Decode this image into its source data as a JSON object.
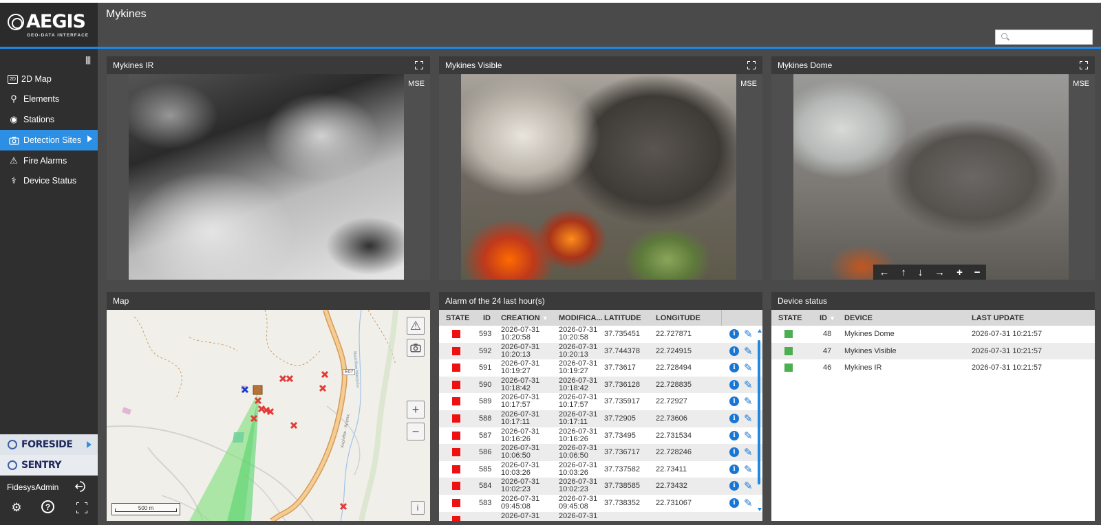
{
  "brand": {
    "name": "AEGIS",
    "tagline": "GEO-DATA INTERFACE"
  },
  "header": {
    "title": "Mykines",
    "search_placeholder": ""
  },
  "sidebar": {
    "items": [
      {
        "label": "2D Map",
        "icon": "map-2d-icon",
        "glyph": "2D"
      },
      {
        "label": "Elements",
        "icon": "location-pin-icon",
        "glyph": "⚲"
      },
      {
        "label": "Stations",
        "icon": "station-icon",
        "glyph": "◉"
      },
      {
        "label": "Detection Sites",
        "icon": "camera-icon",
        "glyph": "📷",
        "active": true
      },
      {
        "label": "Fire Alarms",
        "icon": "warning-icon",
        "glyph": "⚠"
      },
      {
        "label": "Device Status",
        "icon": "stethoscope-icon",
        "glyph": "⚕"
      }
    ],
    "products": [
      "FORESIDE",
      "SENTRY"
    ],
    "user": "FidesysAdmin"
  },
  "cameras": [
    {
      "title": "Mykines IR",
      "badge": "MSE"
    },
    {
      "title": "Mykines Visible",
      "badge": "MSE"
    },
    {
      "title": "Mykines Dome",
      "badge": "MSE"
    }
  ],
  "ptz": [
    "←",
    "↑",
    "↓",
    "→",
    "+",
    "−"
  ],
  "map": {
    "title": "Map",
    "scale_label": "500 m",
    "road_label": "E07",
    "street_label_1": "Ναυπλίου Μυκηνών",
    "street_label_2": "Κορίνθου - Άργους",
    "info_label": "i"
  },
  "alarms": {
    "title": "Alarm of the 24 last hour(s)",
    "columns": [
      "STATE",
      "ID",
      "CREATION",
      "MODIFICA...",
      "LATITUDE",
      "LONGITUDE"
    ],
    "state_color": "#ee1111",
    "rows": [
      {
        "id": "593",
        "c_date": "2026-07-31",
        "c_time": "10:20:58",
        "m_date": "2026-07-31",
        "m_time": "10:20:58",
        "lat": "37.735451",
        "lon": "22.727871"
      },
      {
        "id": "592",
        "c_date": "2026-07-31",
        "c_time": "10:20:13",
        "m_date": "2026-07-31",
        "m_time": "10:20:13",
        "lat": "37.744378",
        "lon": "22.724915"
      },
      {
        "id": "591",
        "c_date": "2026-07-31",
        "c_time": "10:19:27",
        "m_date": "2026-07-31",
        "m_time": "10:19:27",
        "lat": "37.73617",
        "lon": "22.728494"
      },
      {
        "id": "590",
        "c_date": "2026-07-31",
        "c_time": "10:18:42",
        "m_date": "2026-07-31",
        "m_time": "10:18:42",
        "lat": "37.736128",
        "lon": "22.728835"
      },
      {
        "id": "589",
        "c_date": "2026-07-31",
        "c_time": "10:17:57",
        "m_date": "2026-07-31",
        "m_time": "10:17:57",
        "lat": "37.735917",
        "lon": "22.72927"
      },
      {
        "id": "588",
        "c_date": "2026-07-31",
        "c_time": "10:17:11",
        "m_date": "2026-07-31",
        "m_time": "10:17:11",
        "lat": "37.72905",
        "lon": "22.73606"
      },
      {
        "id": "587",
        "c_date": "2026-07-31",
        "c_time": "10:16:26",
        "m_date": "2026-07-31",
        "m_time": "10:16:26",
        "lat": "37.73495",
        "lon": "22.731534"
      },
      {
        "id": "586",
        "c_date": "2026-07-31",
        "c_time": "10:06:50",
        "m_date": "2026-07-31",
        "m_time": "10:06:50",
        "lat": "37.736717",
        "lon": "22.728246"
      },
      {
        "id": "585",
        "c_date": "2026-07-31",
        "c_time": "10:03:26",
        "m_date": "2026-07-31",
        "m_time": "10:03:26",
        "lat": "37.737582",
        "lon": "22.73411"
      },
      {
        "id": "584",
        "c_date": "2026-07-31",
        "c_time": "10:02:23",
        "m_date": "2026-07-31",
        "m_time": "10:02:23",
        "lat": "37.738585",
        "lon": "22.73432"
      },
      {
        "id": "583",
        "c_date": "2026-07-31",
        "c_time": "09:45:08",
        "m_date": "2026-07-31",
        "m_time": "09:45:08",
        "lat": "37.738352",
        "lon": "22.731067"
      },
      {
        "id": "",
        "c_date": "2026-07-31",
        "c_time": "",
        "m_date": "2026-07-31",
        "m_time": "",
        "lat": "",
        "lon": ""
      }
    ]
  },
  "devices": {
    "title": "Device status",
    "columns": [
      "STATE",
      "ID",
      "DEVICE",
      "LAST UPDATE"
    ],
    "state_color": "#4caf50",
    "rows": [
      {
        "id": "48",
        "device": "Mykines Dome",
        "updated": "2026-07-31 10:21:57"
      },
      {
        "id": "47",
        "device": "Mykines Visible",
        "updated": "2026-07-31 10:21:57"
      },
      {
        "id": "46",
        "device": "Mykines IR",
        "updated": "2026-07-31 10:21:57"
      }
    ]
  }
}
